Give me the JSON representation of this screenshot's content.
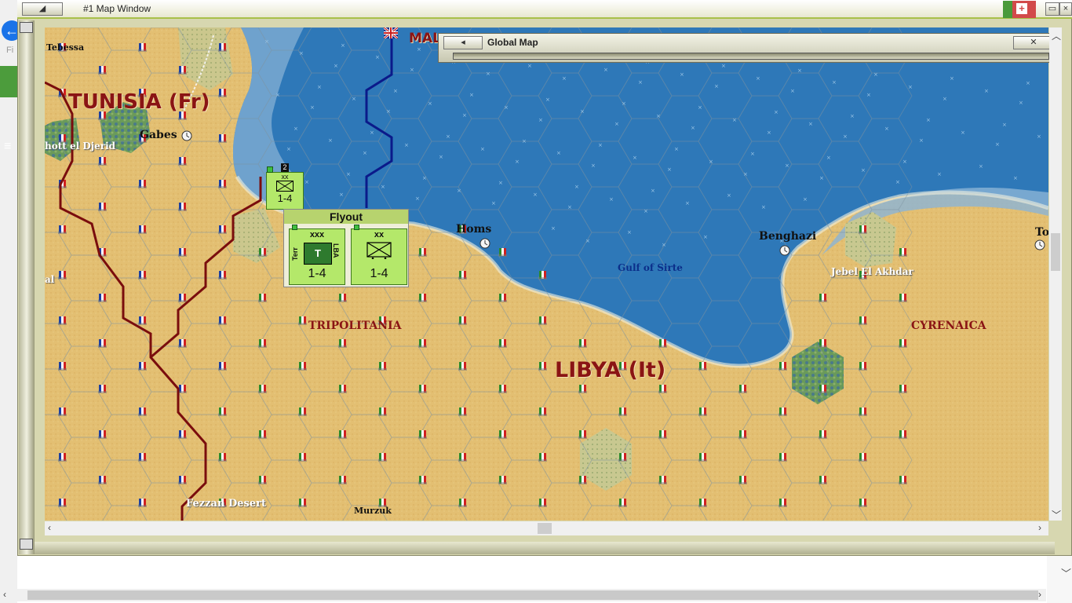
{
  "window": {
    "title": "#1 Map Window",
    "back_glyph": "←",
    "side_text": "Fi"
  },
  "global_map": {
    "title": "Global Map",
    "close_glyph": "✕",
    "nav_glyph": "◂"
  },
  "map": {
    "big_labels": {
      "tunisia": "TUNISIA (Fr)",
      "libya": "LIBYA (It)"
    },
    "partial_label": "MAL",
    "regions": {
      "tripolitania": "TRIPOLITANIA",
      "cyrenaica": "CYRENAICA"
    },
    "cities": {
      "tebessa": "Tebessa",
      "gabes": "Gabes",
      "homs": "Homs",
      "benghazi": "Benghazi",
      "to": "To",
      "murzuk": "Murzuk"
    },
    "features": {
      "chott": "hott el Djerid",
      "jebel": "Jebel El Akhdar",
      "fezzan": "Fezzan Desert",
      "left_edge": "al"
    },
    "sea_label": "Gulf of Sirte",
    "colors": {
      "desert": "#e3bf72",
      "sea": "#2e78b8",
      "shallow": "#8bb4d6",
      "border": "#7a0d0d",
      "front": "#0b1a8a",
      "unit": "#b4e86a"
    }
  },
  "units": {
    "stack": {
      "count": "2",
      "type": "xx",
      "strength": "1-4"
    }
  },
  "flyout": {
    "title": "Flyout",
    "units": [
      {
        "type": "xxx",
        "left_text": "Terr",
        "right_text": "LBA",
        "symbol": "T",
        "strength": "1-4"
      },
      {
        "type": "xx",
        "strength": "1-4"
      }
    ]
  }
}
